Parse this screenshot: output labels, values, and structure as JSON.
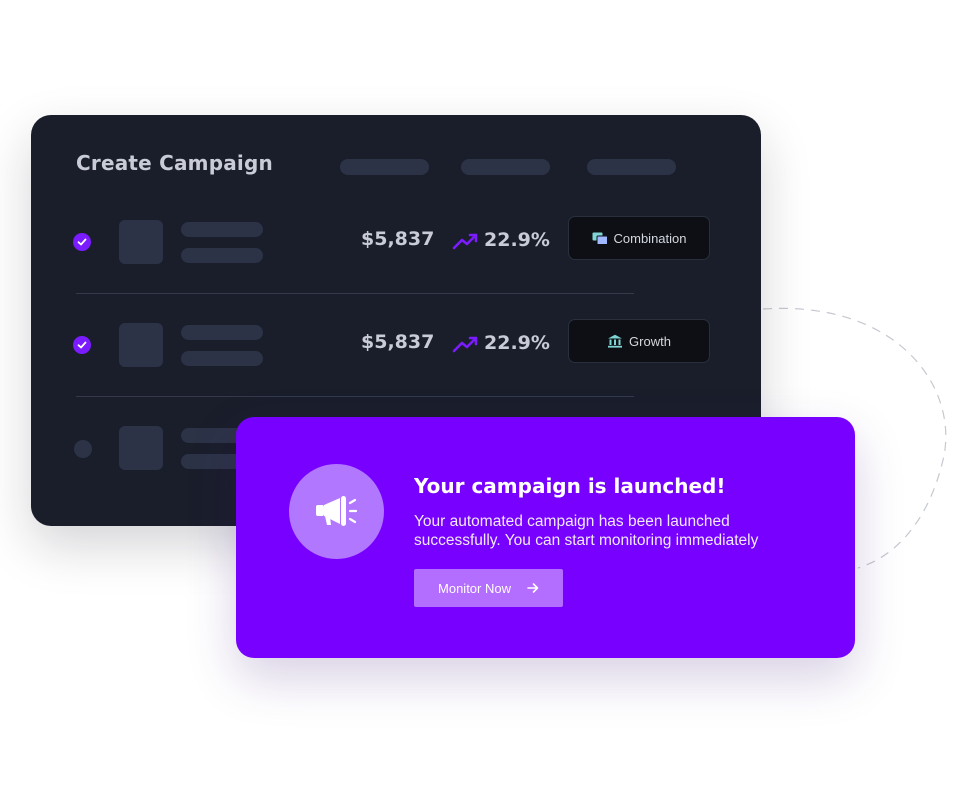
{
  "campaign_card": {
    "title": "Create Campaign",
    "rows": [
      {
        "checked": true,
        "amount": "$5,837",
        "percent": "22.9%",
        "tag_label": "Combination",
        "tag_icon": "cards-icon"
      },
      {
        "checked": true,
        "amount": "$5,837",
        "percent": "22.9%",
        "tag_label": "Growth",
        "tag_icon": "bank-icon"
      },
      {
        "checked": false
      }
    ]
  },
  "toast": {
    "icon": "megaphone-icon",
    "title": "Your campaign is launched!",
    "body": "Your automated campaign has been launched successfully. You can start monitoring immediately",
    "button_label": "Monitor Now",
    "button_icon": "arrow-right-icon"
  },
  "colors": {
    "card_bg": "#1a1e2b",
    "accent_purple": "#7800ff",
    "check_purple": "#7b1bff",
    "button_purple": "#b36dff",
    "tag_icon_teal": "#7fd4d4"
  }
}
